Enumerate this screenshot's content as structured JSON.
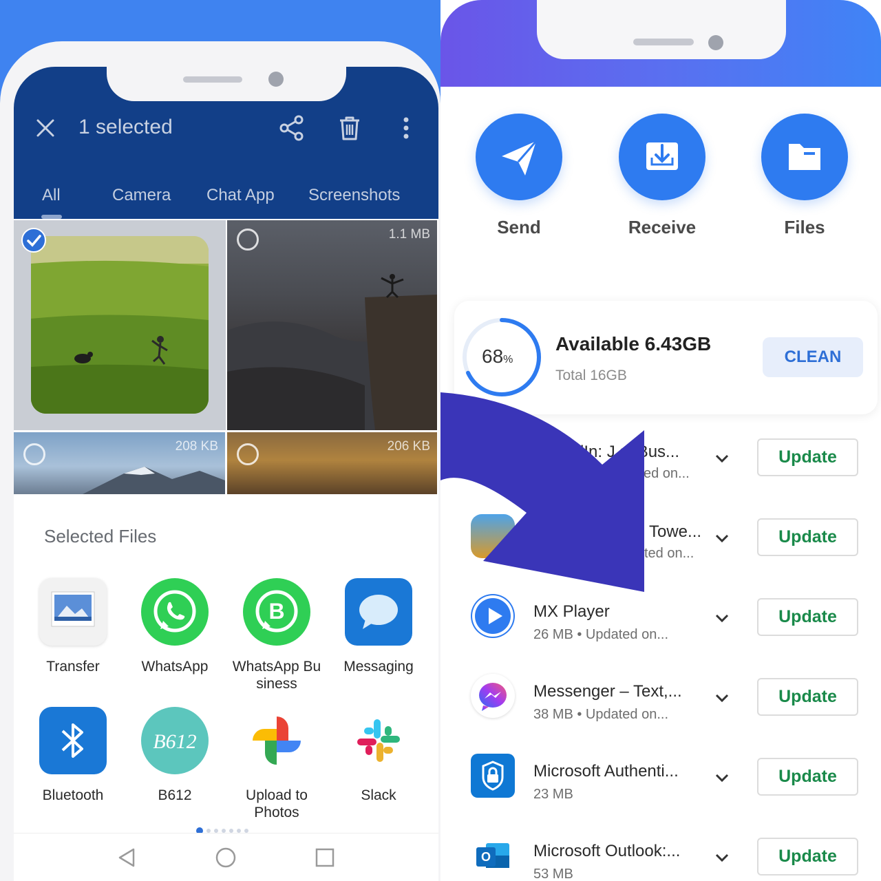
{
  "left_phone": {
    "header": {
      "title": "1 selected",
      "tabs": [
        "All",
        "Camera",
        "Chat App",
        "Screenshots"
      ]
    },
    "gallery": {
      "tiles": [
        {
          "size": "",
          "selected": true
        },
        {
          "size": "1.1 MB",
          "selected": false
        },
        {
          "size": "208 KB",
          "selected": false
        },
        {
          "size": "206 KB",
          "selected": false
        }
      ]
    },
    "share_sheet": {
      "title": "Selected Files",
      "apps": [
        {
          "label": "Transfer",
          "icon": "gallery-photo-icon"
        },
        {
          "label": "WhatsApp",
          "icon": "whatsapp-icon"
        },
        {
          "label": "WhatsApp Bu\nsiness",
          "icon": "whatsapp-business-icon"
        },
        {
          "label": "Messaging",
          "icon": "messaging-bubble-icon"
        },
        {
          "label": "Bluetooth",
          "icon": "bluetooth-icon"
        },
        {
          "label": "B612",
          "icon": "b612-icon"
        },
        {
          "label": "Upload to\nPhotos",
          "icon": "google-photos-icon"
        },
        {
          "label": "Slack",
          "icon": "slack-icon"
        }
      ],
      "page_count": 7,
      "active_page": 1
    }
  },
  "right_phone": {
    "quick_actions": [
      {
        "label": "Send",
        "icon": "paper-plane-icon"
      },
      {
        "label": "Receive",
        "icon": "download-tray-icon"
      },
      {
        "label": "Files",
        "icon": "folder-icon"
      }
    ],
    "storage": {
      "percent": 68,
      "percent_label": "68",
      "percent_sign": "%",
      "available": "Available 6.43GB",
      "total": "Total 16GB",
      "clean_label": "CLEAN"
    },
    "updates": [
      {
        "name": "dIn: J s, Bus...",
        "meta": "ed on...",
        "button": "Update"
      },
      {
        "name": "Towe...",
        "meta": "ted on...",
        "button": "Update"
      },
      {
        "name": "MX Player",
        "meta": "26 MB  •  Updated on...",
        "button": "Update"
      },
      {
        "name": "Messenger – Text,...",
        "meta": "38 MB  •  Updated on...",
        "button": "Update"
      },
      {
        "name": "Microsoft Authenti...",
        "meta": "23 MB",
        "button": "Update"
      },
      {
        "name": "Microsoft Outlook:...",
        "meta": "53 MB",
        "button": "Update"
      }
    ]
  },
  "colors": {
    "left_appbar": "#123f88",
    "left_background": "#3f83f0",
    "accent_blue": "#2e7bf0",
    "update_green": "#1a8a4a",
    "arrow_overlay": "#3a35b8"
  }
}
